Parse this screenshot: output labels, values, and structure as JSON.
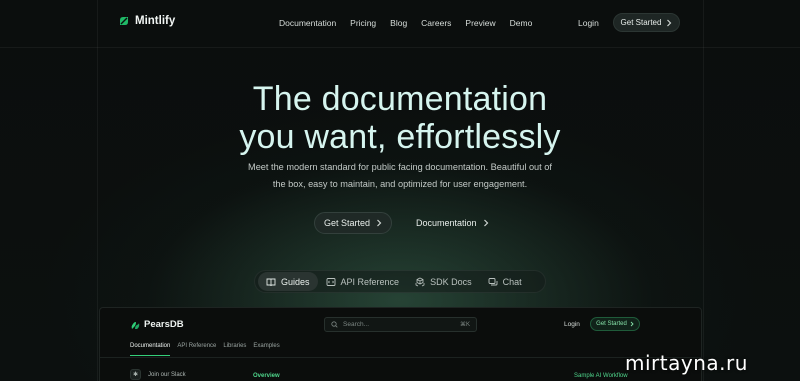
{
  "nav": {
    "brand": "Mintlify",
    "links": [
      "Documentation",
      "Pricing",
      "Blog",
      "Careers",
      "Preview",
      "Demo"
    ],
    "login": "Login",
    "cta": "Get Started",
    "cta_icon": "chevron-right-icon"
  },
  "hero": {
    "title_line1": "The documentation",
    "title_line2": "you want, effortlessly",
    "subtitle_line1": "Meet the modern standard for public facing documentation. Beautiful out of",
    "subtitle_line2": "the box, easy to maintain, and optimized for user engagement.",
    "primary_button": "Get Started",
    "secondary_button": "Documentation"
  },
  "tabs": [
    {
      "label": "Guides",
      "icon": "book-icon",
      "active": true
    },
    {
      "label": "API Reference",
      "icon": "code-icon",
      "active": false
    },
    {
      "label": "SDK Docs",
      "icon": "cubes-icon",
      "active": false
    },
    {
      "label": "Chat",
      "icon": "chat-icon",
      "active": false
    }
  ],
  "preview": {
    "brand": "PearsDB",
    "search_placeholder": "Search...",
    "search_shortcut": "⌘K",
    "login": "Login",
    "cta": "Get Started",
    "tabs": [
      "Documentation",
      "API Reference",
      "Libraries",
      "Examples"
    ],
    "active_tab": "Documentation",
    "slack": "Join our Slack",
    "section_heading": "Overview",
    "right_heading": "Sample AI Workflow"
  },
  "watermark": "mirtayna.ru",
  "colors": {
    "background": "#0a0d0c",
    "title": "#d6f5ef",
    "accent_green": "#34d07a"
  }
}
